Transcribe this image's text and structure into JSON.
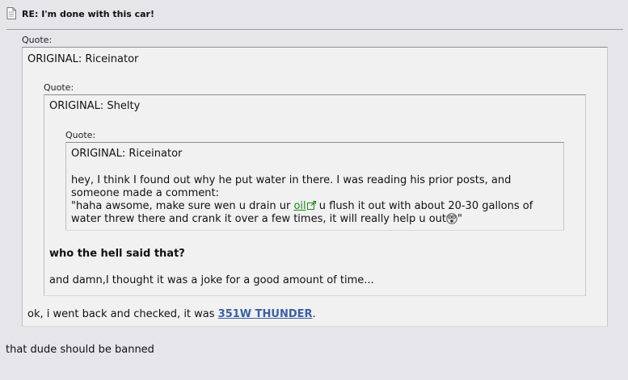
{
  "post": {
    "title": "RE: I'm done with this car!",
    "icon": "page-icon"
  },
  "quotes": {
    "outer": {
      "label": "Quote:",
      "original": "ORIGINAL: Riceinator",
      "footer_prefix": "ok, i went back and checked, it was ",
      "footer_link": "351W THUNDER",
      "footer_suffix": "."
    },
    "middle": {
      "label": "Quote:",
      "original": "ORIGINAL: Shelty",
      "question": "who the hell said that?",
      "remark": "and damn,I thought it was a joke for a good amount of time..."
    },
    "inner": {
      "label": "Quote:",
      "original": "ORIGINAL: Riceinator",
      "line1": "hey, I think I found out why he put water in there. I was reading his prior posts, and",
      "line2": "someone made a comment:",
      "line3_prefix": "\"haha awsome, make sure wen u drain ur ",
      "line3_link": "oil",
      "line3_suffix": " u flush it out with about 20-30 gallons of",
      "line4_prefix": "water threw there and crank it over a few times, it will really help u out",
      "line4_suffix": "\"",
      "emoji": "surprised-emoji-icon"
    }
  },
  "reply": "that dude should be banned",
  "colors": {
    "background": "#e6e6ea",
    "quote_bg": "#f1f1f1",
    "link_green": "#1a8a1a",
    "user_link": "#3a5fa4"
  }
}
